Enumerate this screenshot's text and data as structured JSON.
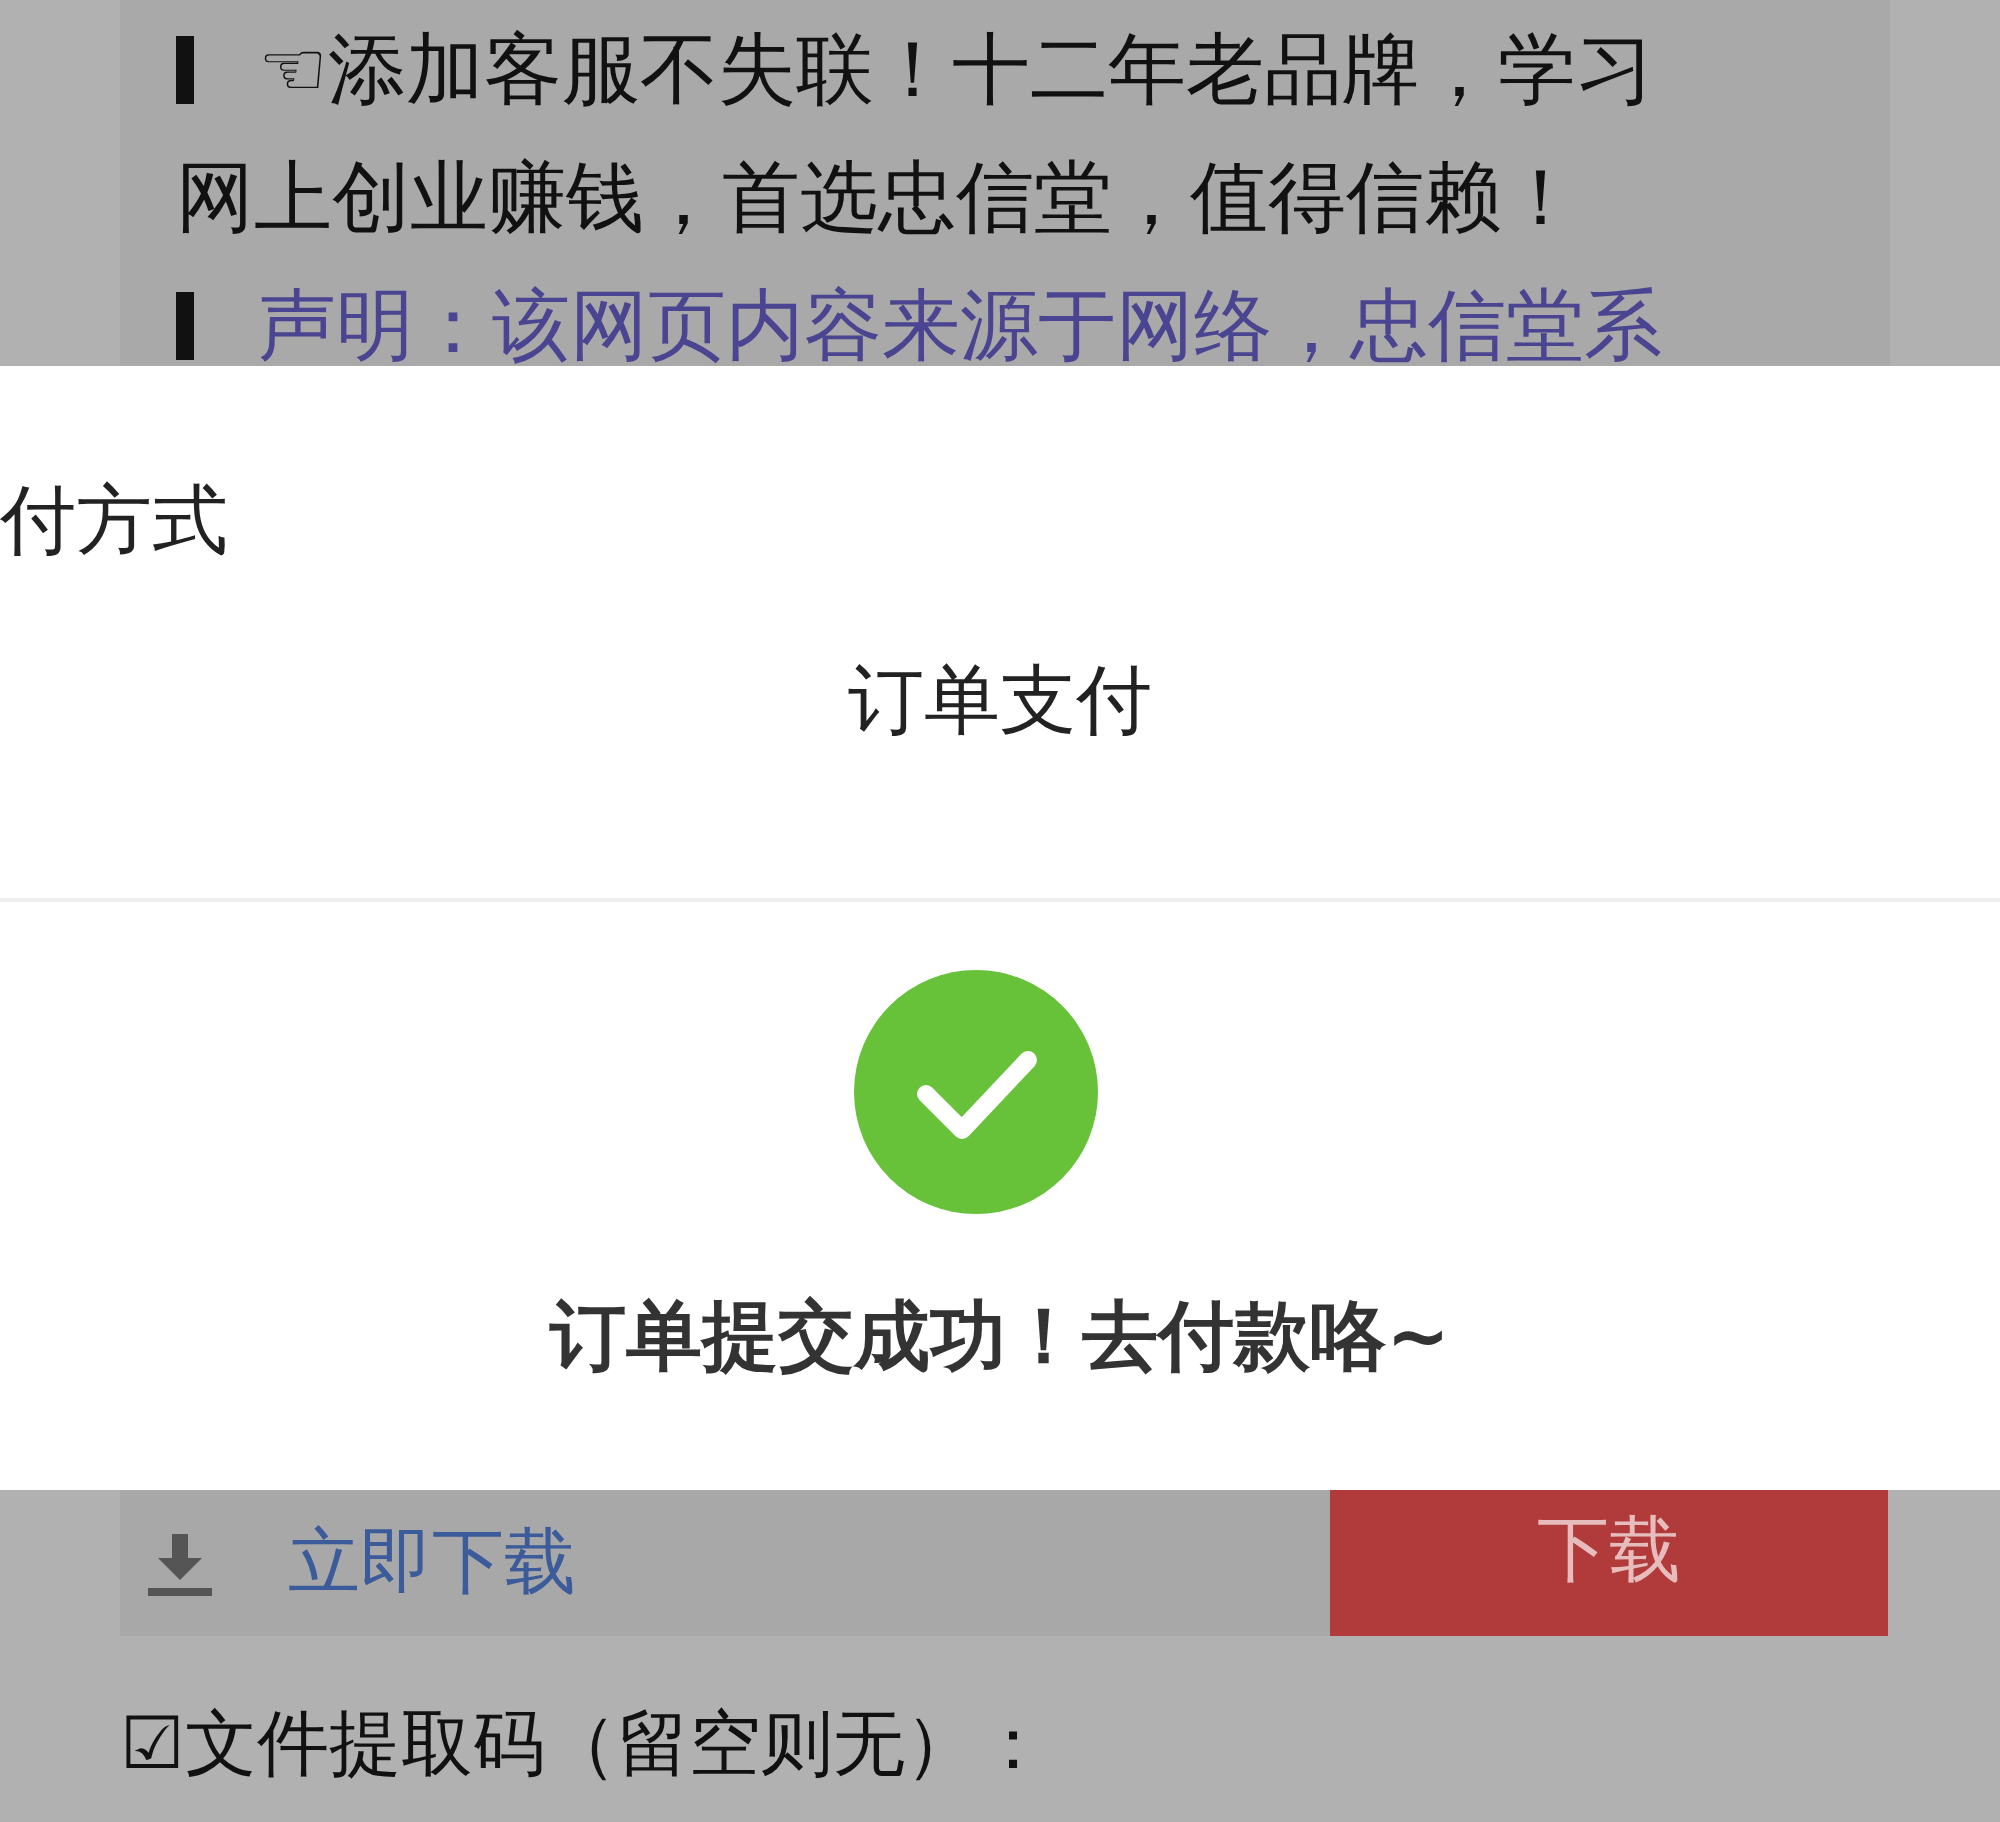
{
  "notice": {
    "paragraphs": [
      {
        "kind": "plain",
        "text": "☜添加客服不失联！十二年老品牌，学习网上创业赚钱，首选忠信堂，值得信赖！"
      },
      {
        "kind": "link",
        "text": "声明：该网页内容来源于网络，忠信堂系"
      }
    ]
  },
  "sheet": {
    "cut_title": "付方式",
    "title": "订单支付",
    "success": {
      "message": "订单提交成功！去付款咯~"
    }
  },
  "download": {
    "link": "立即下载",
    "button": "下载"
  },
  "extract_code": {
    "label": "☑文件提取码（留空则无）："
  }
}
